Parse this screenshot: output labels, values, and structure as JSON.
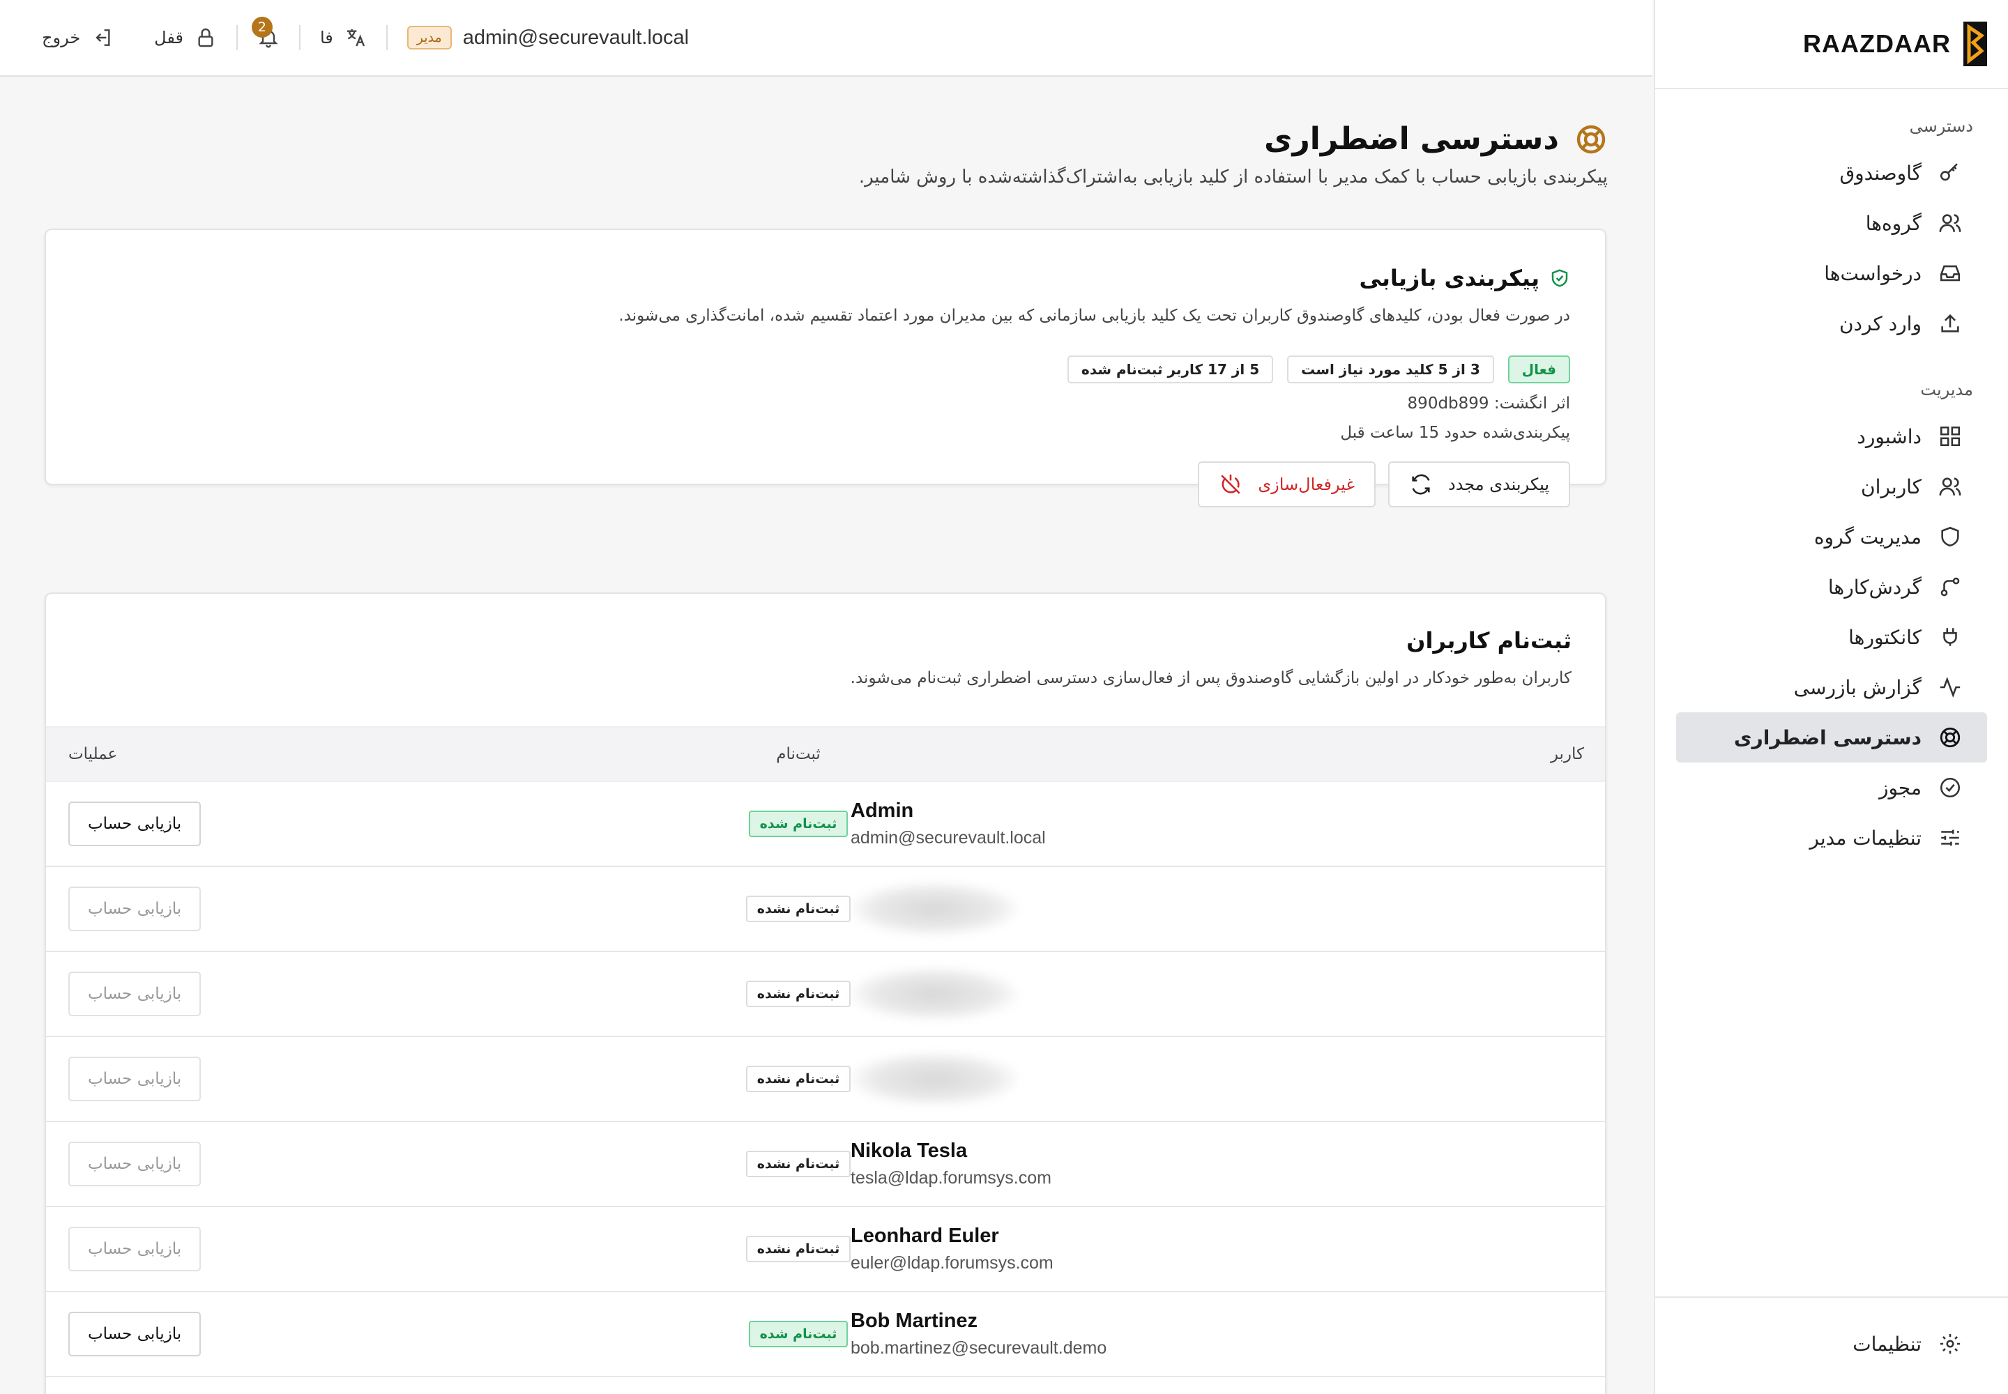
{
  "brand": {
    "name": "RAAZDAAR"
  },
  "sidebar": {
    "sections": [
      {
        "title": "دسترسی",
        "items": [
          {
            "label": "گاوصندوق",
            "icon": "key-icon"
          },
          {
            "label": "گروه‌ها",
            "icon": "users-icon"
          },
          {
            "label": "درخواست‌ها",
            "icon": "inbox-icon"
          },
          {
            "label": "وارد کردن",
            "icon": "upload-icon"
          }
        ]
      },
      {
        "title": "مدیریت",
        "items": [
          {
            "label": "داشبورد",
            "icon": "dashboard-icon"
          },
          {
            "label": "کاربران",
            "icon": "users-icon"
          },
          {
            "label": "مدیریت گروه",
            "icon": "shield-icon"
          },
          {
            "label": "گردش‌کارها",
            "icon": "workflow-icon"
          },
          {
            "label": "کانکتورها",
            "icon": "plug-icon"
          },
          {
            "label": "گزارش بازرسی",
            "icon": "activity-icon"
          },
          {
            "label": "دسترسی اضطراری",
            "icon": "lifebuoy-icon",
            "active": true
          },
          {
            "label": "مجوز",
            "icon": "badge-check-icon"
          },
          {
            "label": "تنظیمات مدیر",
            "icon": "sliders-icon"
          }
        ]
      }
    ],
    "bottom": {
      "label": "تنظیمات",
      "icon": "gear-icon"
    }
  },
  "topbar": {
    "logout": "خروج",
    "lock": "قفل",
    "notifications_count": "2",
    "language": "فا",
    "role": "مدیر",
    "email": "admin@securevault.local"
  },
  "page": {
    "title": "دسترسی اضطراری",
    "subtitle": "پیکربندی بازیابی حساب با کمک مدیر با استفاده از کلید بازیابی به‌اشتراک‌گذاشته‌شده با روش شامیر."
  },
  "recovery_card": {
    "title": "پیکربندی بازیابی",
    "description": "در صورت فعال بودن، کلیدهای گاوصندوق کاربران تحت یک کلید بازیابی سازمانی که بین مدیران مورد اعتماد تقسیم شده، امانت‌گذاری می‌شوند.",
    "status": "فعال",
    "keys_required": "3 از 5 کلید مورد نیاز است",
    "users_enrolled": "5 از 17 کاربر ثبت‌نام شده",
    "fingerprint": "اثر انگشت: 890db899",
    "configured": "پیکربندی‌شده حدود 15 ساعت قبل",
    "reconfigure": "پیکربندی مجدد",
    "disable": "غیرفعال‌سازی"
  },
  "enrollment_card": {
    "title": "ثبت‌نام کاربران",
    "description": "کاربران به‌طور خودکار در اولین بازگشایی گاوصندوق پس از فعال‌سازی دسترسی اضطراری ثبت‌نام می‌شوند.",
    "columns": {
      "user": "کاربر",
      "enrollment": "ثبت‌نام",
      "actions": "عملیات"
    },
    "rows": [
      {
        "name": "Admin",
        "email": "admin@securevault.local",
        "status": "ثبت‌نام شده",
        "enrolled": true,
        "action": "بازیابی حساب"
      },
      {
        "name": "",
        "email": "",
        "status": "ثبت‌نام نشده",
        "enrolled": false,
        "action": "بازیابی حساب"
      },
      {
        "name": "",
        "email": "",
        "status": "ثبت‌نام نشده",
        "enrolled": false,
        "action": "بازیابی حساب"
      },
      {
        "name": "",
        "email": "",
        "status": "ثبت‌نام نشده",
        "enrolled": false,
        "action": "بازیابی حساب"
      },
      {
        "name": "Nikola Tesla",
        "email": "tesla@ldap.forumsys.com",
        "status": "ثبت‌نام نشده",
        "enrolled": false,
        "action": "بازیابی حساب"
      },
      {
        "name": "Leonhard Euler",
        "email": "euler@ldap.forumsys.com",
        "status": "ثبت‌نام نشده",
        "enrolled": false,
        "action": "بازیابی حساب"
      },
      {
        "name": "Bob Martinez",
        "email": "bob.martinez@securevault.demo",
        "status": "ثبت‌نام شده",
        "enrolled": true,
        "action": "بازیابی حساب"
      }
    ]
  },
  "colors": {
    "accent": "#b5751a",
    "success": "#12924a",
    "danger": "#d32424",
    "active_nav": "#e3e4e8"
  }
}
